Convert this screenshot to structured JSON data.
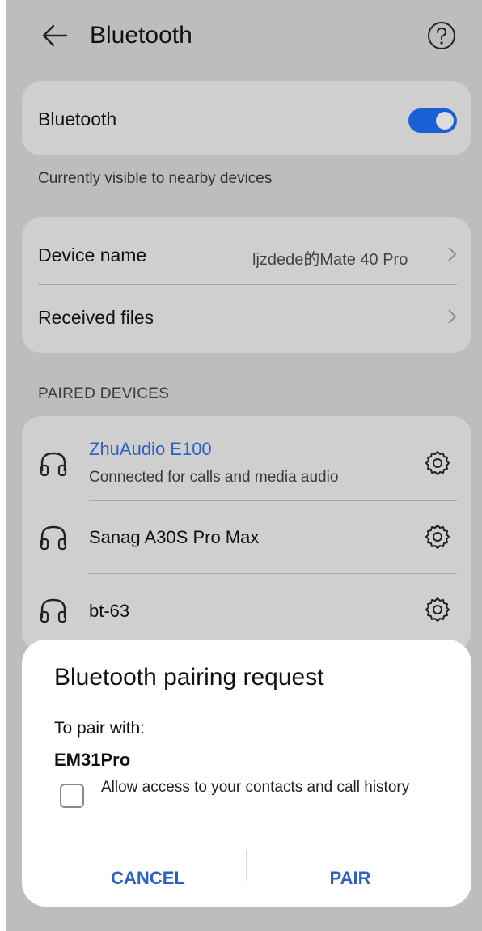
{
  "header": {
    "title": "Bluetooth",
    "back_icon": "back-arrow-icon",
    "help_icon": "help-icon"
  },
  "bluetooth_card": {
    "label": "Bluetooth",
    "toggle_on": true,
    "accent_color": "#1b5fd4"
  },
  "visibility_note": "Currently visible to nearby devices",
  "settings_card": {
    "device_name_label": "Device name",
    "device_name_value": "ljzdede的Mate 40 Pro",
    "received_files_label": "Received files"
  },
  "paired_section": {
    "heading": "PAIRED DEVICES",
    "devices": [
      {
        "name": "ZhuAudio E100",
        "status": "Connected for calls and media audio",
        "icon": "headphones-icon"
      },
      {
        "name": "Sanag A30S Pro Max",
        "status": "",
        "icon": "headphones-icon"
      },
      {
        "name": "bt-63",
        "status": "",
        "icon": "headphones-icon"
      }
    ]
  },
  "dialog": {
    "title": "Bluetooth pairing request",
    "prompt": "To pair with:",
    "device": "EM31Pro",
    "checkbox_label": "Allow access to your contacts and call history",
    "checkbox_checked": false,
    "cancel_label": "CANCEL",
    "pair_label": "PAIR",
    "button_color": "#2d61c7"
  }
}
